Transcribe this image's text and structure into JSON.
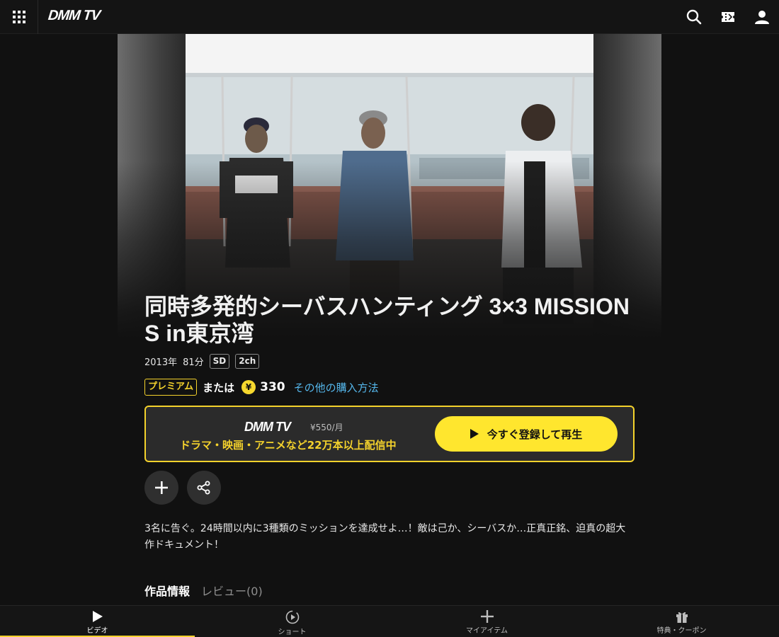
{
  "header": {
    "logo": "DMM TV",
    "icons": [
      "grid-menu-icon",
      "search-icon",
      "ticket-icon",
      "user-icon"
    ]
  },
  "title": "同時多発的シーバスハンティング 3×3 MISSIONS in東京湾",
  "meta": {
    "year": "2013年",
    "duration": "81分",
    "badges": [
      "SD",
      "2ch"
    ]
  },
  "purchase": {
    "premium_label": "プレミアム",
    "or_label": "または",
    "yen_symbol": "¥",
    "price": "330",
    "other_methods_label": "その他の購入方法"
  },
  "promo": {
    "logo": "DMM TV",
    "monthly_price": "¥550/月",
    "tagline": "ドラマ・映画・アニメなど22万本以上配信中",
    "cta_label": "今すぐ登録して再生"
  },
  "actions": {
    "icons": [
      "plus-icon",
      "share-icon"
    ]
  },
  "description": "3名に告ぐ。24時間以内に3種類のミッションを達成せよ…！敵は己か、シーバスか…正真正銘、迫真の超大作ドキュメント！",
  "tabs": [
    {
      "label": "作品情報",
      "active": true
    },
    {
      "label": "レビュー(0)",
      "active": false
    }
  ],
  "bottom_nav": [
    {
      "label": "ビデオ",
      "icon": "play-icon",
      "active": true
    },
    {
      "label": "ショート",
      "icon": "short-play-icon",
      "active": false
    },
    {
      "label": "マイアイテム",
      "icon": "plus-icon",
      "active": false
    },
    {
      "label": "特典・クーポン",
      "icon": "gift-icon",
      "active": false
    }
  ],
  "colors": {
    "accent_yellow": "#f4d22c",
    "cta_yellow": "#ffe62e",
    "link_blue": "#55b7ec",
    "background": "#111111"
  }
}
